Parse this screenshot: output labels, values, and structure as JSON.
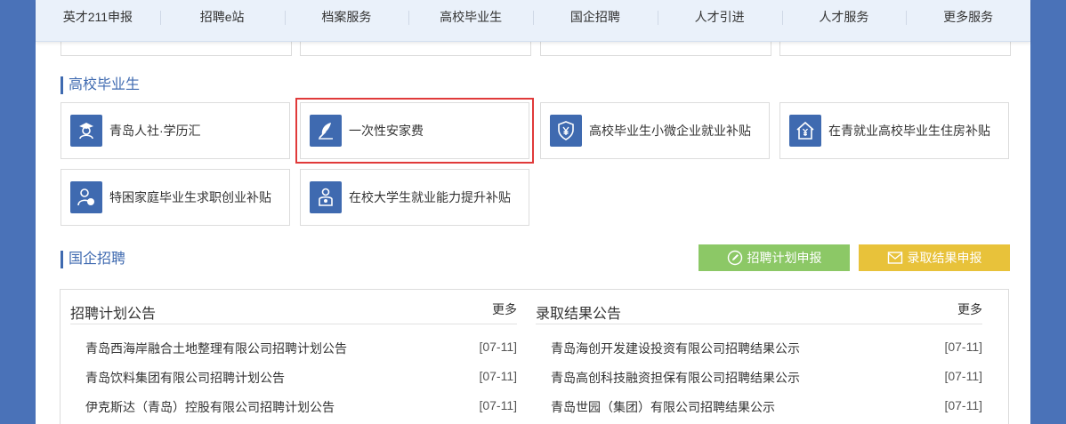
{
  "nav": [
    "英才211申报",
    "招聘e站",
    "档案服务",
    "高校毕业生",
    "国企招聘",
    "人才引进",
    "人才服务",
    "更多服务"
  ],
  "graduates": {
    "title": "高校毕业生",
    "cards": [
      {
        "label": "青岛人社·学历汇",
        "icon": "graduate-icon"
      },
      {
        "label": "一次性安家费",
        "icon": "feather-icon"
      },
      {
        "label": "高校毕业生小微企业就业补贴",
        "icon": "shield-yen-icon"
      },
      {
        "label": "在青就业高校毕业生住房补贴",
        "icon": "house-yen-icon"
      },
      {
        "label": "特困家庭毕业生求职创业补贴",
        "icon": "person-coin-icon"
      },
      {
        "label": "在校大学生就业能力提升补贴",
        "icon": "student-badge-icon"
      }
    ]
  },
  "soe": {
    "title": "国企招聘",
    "btn_plan": "招聘计划申报",
    "btn_result": "录取结果申报",
    "colors": {
      "plan": "#8cc866",
      "result": "#e8c23a",
      "accent": "#3f6ab0",
      "highlight": "#e03a3a"
    }
  },
  "plan_notices": {
    "title": "招聘计划公告",
    "more": "更多",
    "items": [
      {
        "text": "青岛西海岸融合土地整理有限公司招聘计划公告",
        "date": "[07-11]"
      },
      {
        "text": "青岛饮料集团有限公司招聘计划公告",
        "date": "[07-11]"
      },
      {
        "text": "伊克斯达（青岛）控股有限公司招聘计划公告",
        "date": "[07-11]"
      }
    ]
  },
  "result_notices": {
    "title": "录取结果公告",
    "more": "更多",
    "items": [
      {
        "text": "青岛海创开发建设投资有限公司招聘结果公示",
        "date": "[07-11]"
      },
      {
        "text": "青岛高创科技融资担保有限公司招聘结果公示",
        "date": "[07-11]"
      },
      {
        "text": "青岛世园（集团）有限公司招聘结果公示",
        "date": "[07-11]"
      }
    ]
  }
}
